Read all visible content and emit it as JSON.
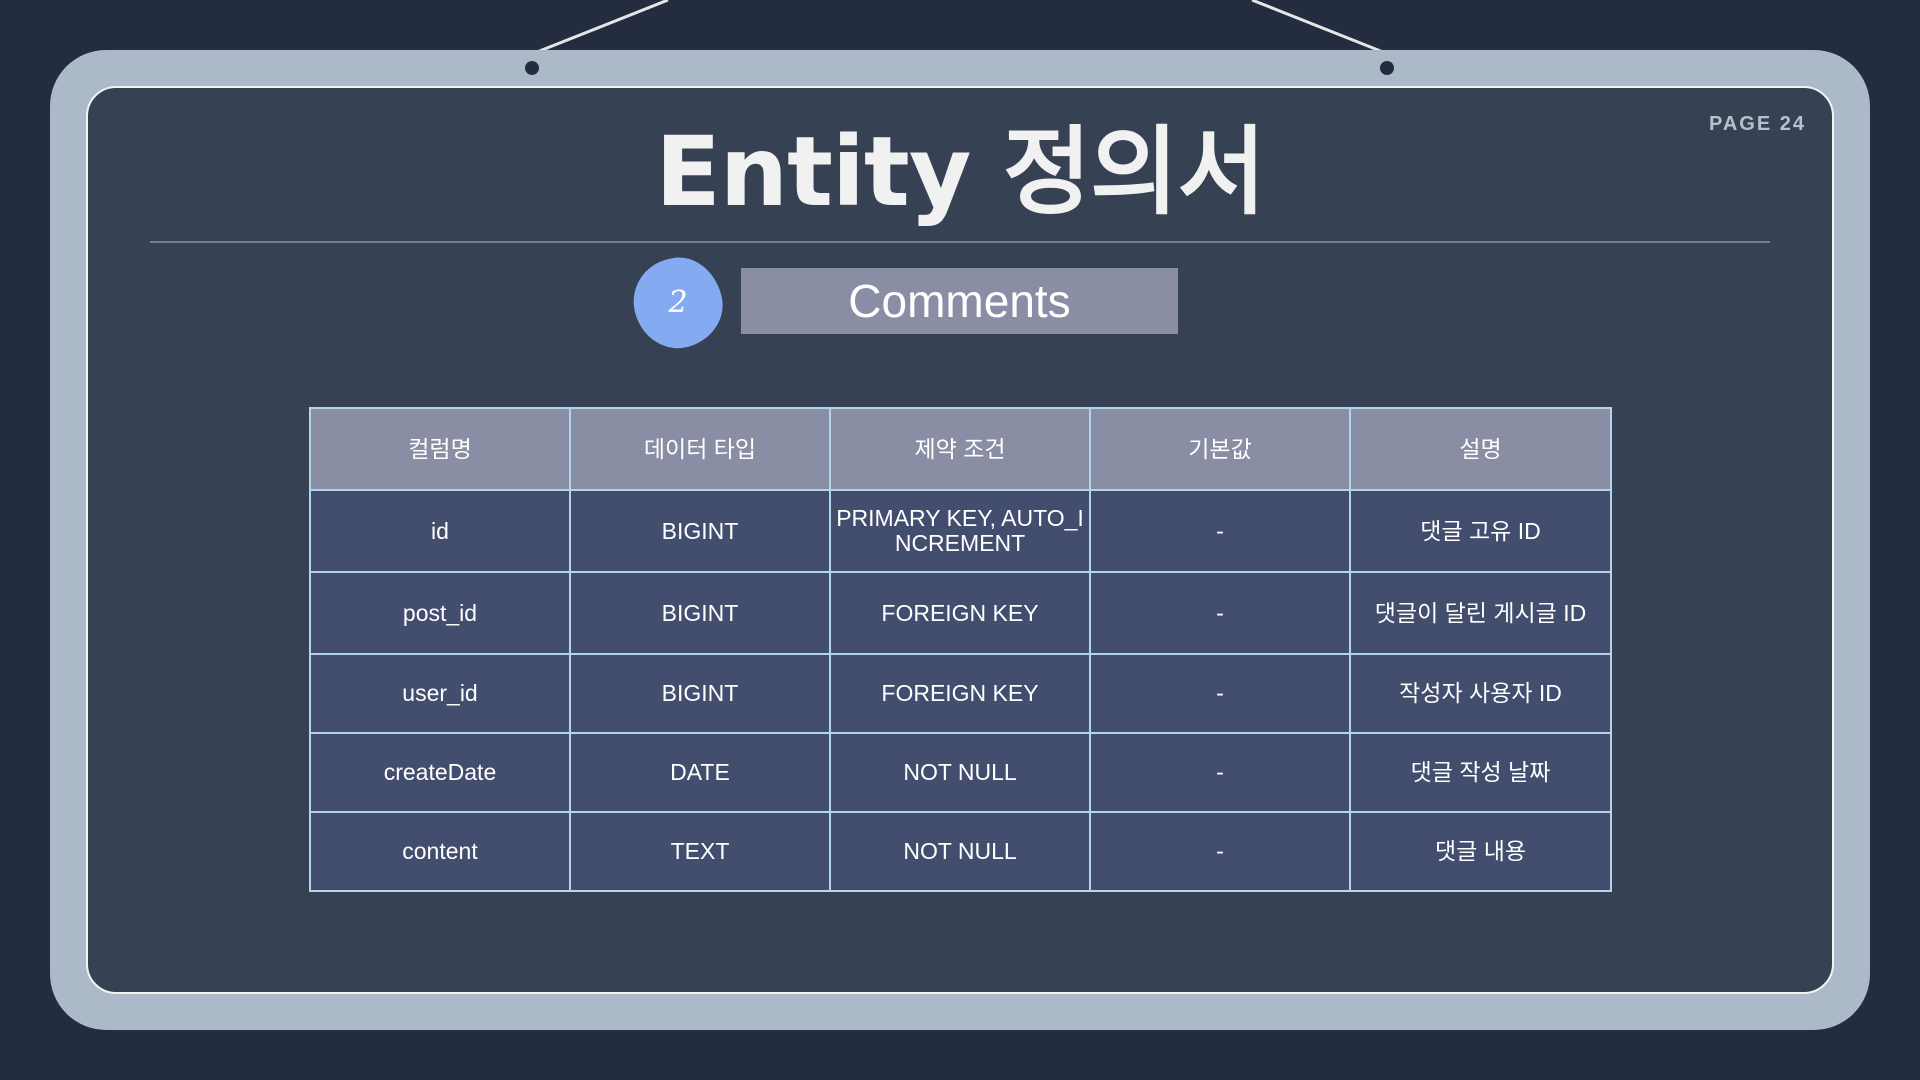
{
  "page": {
    "label": "PAGE 24",
    "title": "Entity 정의서"
  },
  "section": {
    "number": "2",
    "name": "Comments"
  },
  "table": {
    "headers": [
      "컬럼명",
      "데이터 타입",
      "제약 조건",
      "기본값",
      "설명"
    ],
    "rows": [
      [
        "id",
        "BIGINT",
        "PRIMARY KEY, AUTO_INCREMENT",
        "-",
        "댓글 고유 ID"
      ],
      [
        "post_id",
        "BIGINT",
        "FOREIGN KEY",
        "-",
        "댓글이 달린 게시글 ID"
      ],
      [
        "user_id",
        "BIGINT",
        "FOREIGN KEY",
        "-",
        "작성자 사용자 ID"
      ],
      [
        "createDate",
        "DATE",
        "NOT NULL",
        "-",
        "댓글 작성 날짜"
      ],
      [
        "content",
        "TEXT",
        "NOT NULL",
        "-",
        "댓글 내용"
      ]
    ]
  },
  "colors": {
    "background": "#242c40",
    "frame": "#abb9c8",
    "board": "#364154",
    "header_cell": "#8a8ea4",
    "body_cell": "#434d6d",
    "badge": "#84aaf2"
  }
}
